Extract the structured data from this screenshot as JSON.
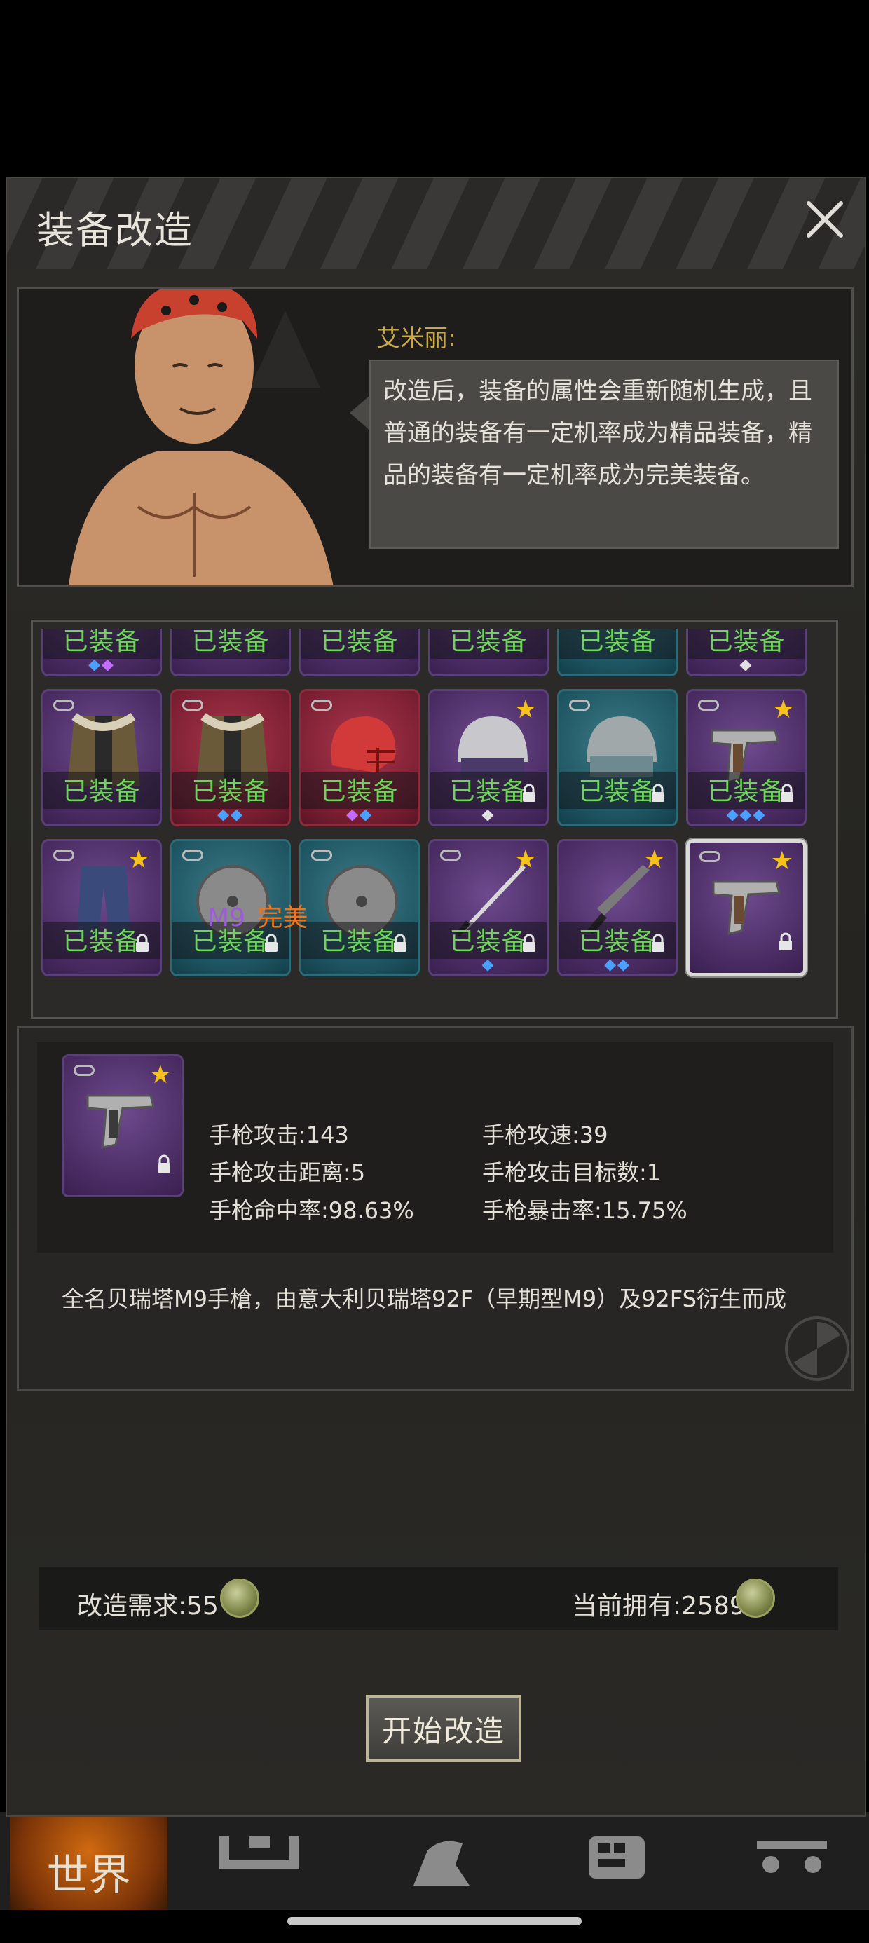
{
  "dialog": {
    "title": "装备改造",
    "close_icon": "close-icon"
  },
  "npc": {
    "name": "艾米丽:",
    "speech": "改造后，装备的属性会重新随机生成，且普通的装备有一定机率成为精品装备，精品的装备有一定机率成为完美装备。"
  },
  "equipped_label": "已装备",
  "grid": {
    "rows": [
      [
        {
          "color": "purple",
          "gems": [
            "blue",
            "purple"
          ],
          "link": false,
          "star": false,
          "lock": false,
          "icon": "cut-off-item"
        },
        {
          "color": "purple",
          "gems": [],
          "link": false,
          "star": false,
          "lock": false,
          "icon": "cut-off-item"
        },
        {
          "color": "purple",
          "gems": [],
          "link": false,
          "star": false,
          "lock": false,
          "icon": "cut-off-item"
        },
        {
          "color": "purple",
          "gems": [],
          "link": false,
          "star": false,
          "lock": false,
          "icon": "cut-off-item"
        },
        {
          "color": "blue",
          "gems": [],
          "link": false,
          "star": false,
          "lock": false,
          "icon": "cut-off-item"
        },
        {
          "color": "purple",
          "gems": [
            "white"
          ],
          "link": false,
          "star": false,
          "lock": false,
          "icon": "cut-off-item"
        }
      ],
      [
        {
          "color": "purple",
          "gems": [],
          "link": true,
          "star": false,
          "lock": false,
          "icon": "fur-parka-icon"
        },
        {
          "color": "red",
          "gems": [
            "blue",
            "blue"
          ],
          "link": true,
          "star": false,
          "lock": false,
          "icon": "fur-parka-icon"
        },
        {
          "color": "red",
          "gems": [
            "purple",
            "blue"
          ],
          "link": true,
          "star": false,
          "lock": false,
          "icon": "football-helmet-icon"
        },
        {
          "color": "purple",
          "gems": [
            "white"
          ],
          "link": false,
          "star": true,
          "lock": true,
          "icon": "police-helmet-icon"
        },
        {
          "color": "blue",
          "gems": [],
          "link": true,
          "star": false,
          "lock": true,
          "icon": "riot-helmet-icon"
        },
        {
          "color": "purple",
          "gems": [
            "blue",
            "blue",
            "blue"
          ],
          "link": true,
          "star": true,
          "lock": true,
          "icon": "pistol-icon"
        }
      ],
      [
        {
          "color": "purple",
          "gems": [],
          "link": true,
          "star": true,
          "lock": true,
          "icon": "jeans-icon"
        },
        {
          "color": "blue",
          "gems": [],
          "link": true,
          "star": false,
          "lock": true,
          "icon": "round-shield-icon"
        },
        {
          "color": "blue",
          "gems": [],
          "link": true,
          "star": false,
          "lock": true,
          "icon": "round-shield-icon"
        },
        {
          "color": "purple",
          "gems": [
            "blue"
          ],
          "link": true,
          "star": true,
          "lock": true,
          "icon": "katana-icon"
        },
        {
          "color": "purple",
          "gems": [
            "blue",
            "blue"
          ],
          "link": false,
          "star": true,
          "lock": true,
          "icon": "machete-icon"
        },
        {
          "color": "purple",
          "gems": [],
          "link": true,
          "star": true,
          "lock": true,
          "icon": "pistol-icon",
          "selected": true,
          "no_label": true
        }
      ]
    ]
  },
  "detail": {
    "name": "M9",
    "quality": "完美",
    "stats": {
      "attack": "手枪攻击:143",
      "speed": "手枪攻速:39",
      "range": "手枪攻击距离:5",
      "targets": "手枪攻击目标数:1",
      "hit": "手枪命中率:98.63%",
      "crit": "手枪暴击率:15.75%"
    },
    "description": "全名贝瑞塔M9手槍，由意大利贝瑞塔92F（早期型M9）及92FS衍生而成"
  },
  "cost": {
    "required": "改造需求:55",
    "owned": "当前拥有:2589"
  },
  "start_button": "开始改造",
  "bottom_nav": {
    "world": "世界"
  },
  "colors": {
    "equipped_green": "#6fd35c",
    "star_gold": "#f5c21a",
    "quality_orange": "#f0741a",
    "name_purple": "#9b5cd6",
    "speaker_gold": "#c9a94a"
  }
}
